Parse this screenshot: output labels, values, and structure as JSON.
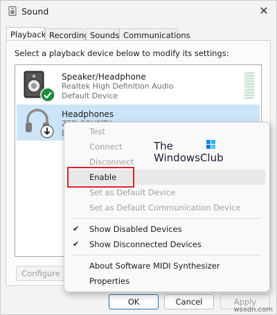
{
  "window": {
    "title": "Sound",
    "close_label": "✕"
  },
  "tabs": [
    {
      "label": "Playback",
      "active": true
    },
    {
      "label": "Recording",
      "active": false
    },
    {
      "label": "Sounds",
      "active": false
    },
    {
      "label": "Communications",
      "active": false
    }
  ],
  "instruction": "Select a playback device below to modify its settings:",
  "devices": [
    {
      "name": "Speaker/Headphone",
      "line1": "Realtek High Definition Audio",
      "line2": "Default Device",
      "status_icon": "green-check-icon"
    },
    {
      "name": "Headphones",
      "line1": "ZED COUNTY",
      "line2": "D",
      "status_icon": "down-arrow-icon",
      "selected": true
    }
  ],
  "buttons": {
    "configure": "Configure",
    "ok": "OK",
    "cancel": "Cancel",
    "apply": "Apply"
  },
  "context_menu": {
    "items": [
      {
        "label": "Test",
        "enabled": false
      },
      {
        "label": "Connect",
        "enabled": false
      },
      {
        "label": "Disconnect",
        "enabled": false
      },
      {
        "label": "Enable",
        "enabled": true,
        "highlighted": true
      },
      {
        "label": "Set as Default Device",
        "enabled": false
      },
      {
        "label": "Set as Default Communication Device",
        "enabled": false
      },
      {
        "label": "Show Disabled Devices",
        "enabled": true,
        "checked": true
      },
      {
        "label": "Show Disconnected Devices",
        "enabled": true,
        "checked": true
      },
      {
        "label": "About Software MIDI Synthesizer",
        "enabled": true
      },
      {
        "label": "Properties",
        "enabled": true
      }
    ]
  },
  "watermark": {
    "line1": "The",
    "line2": "WindowsClub"
  },
  "site_watermark": "wsxdn.com",
  "colors": {
    "selection": "#cce4f7",
    "highlight_box": "#d6232c",
    "check_green": "#1e8a3e"
  }
}
